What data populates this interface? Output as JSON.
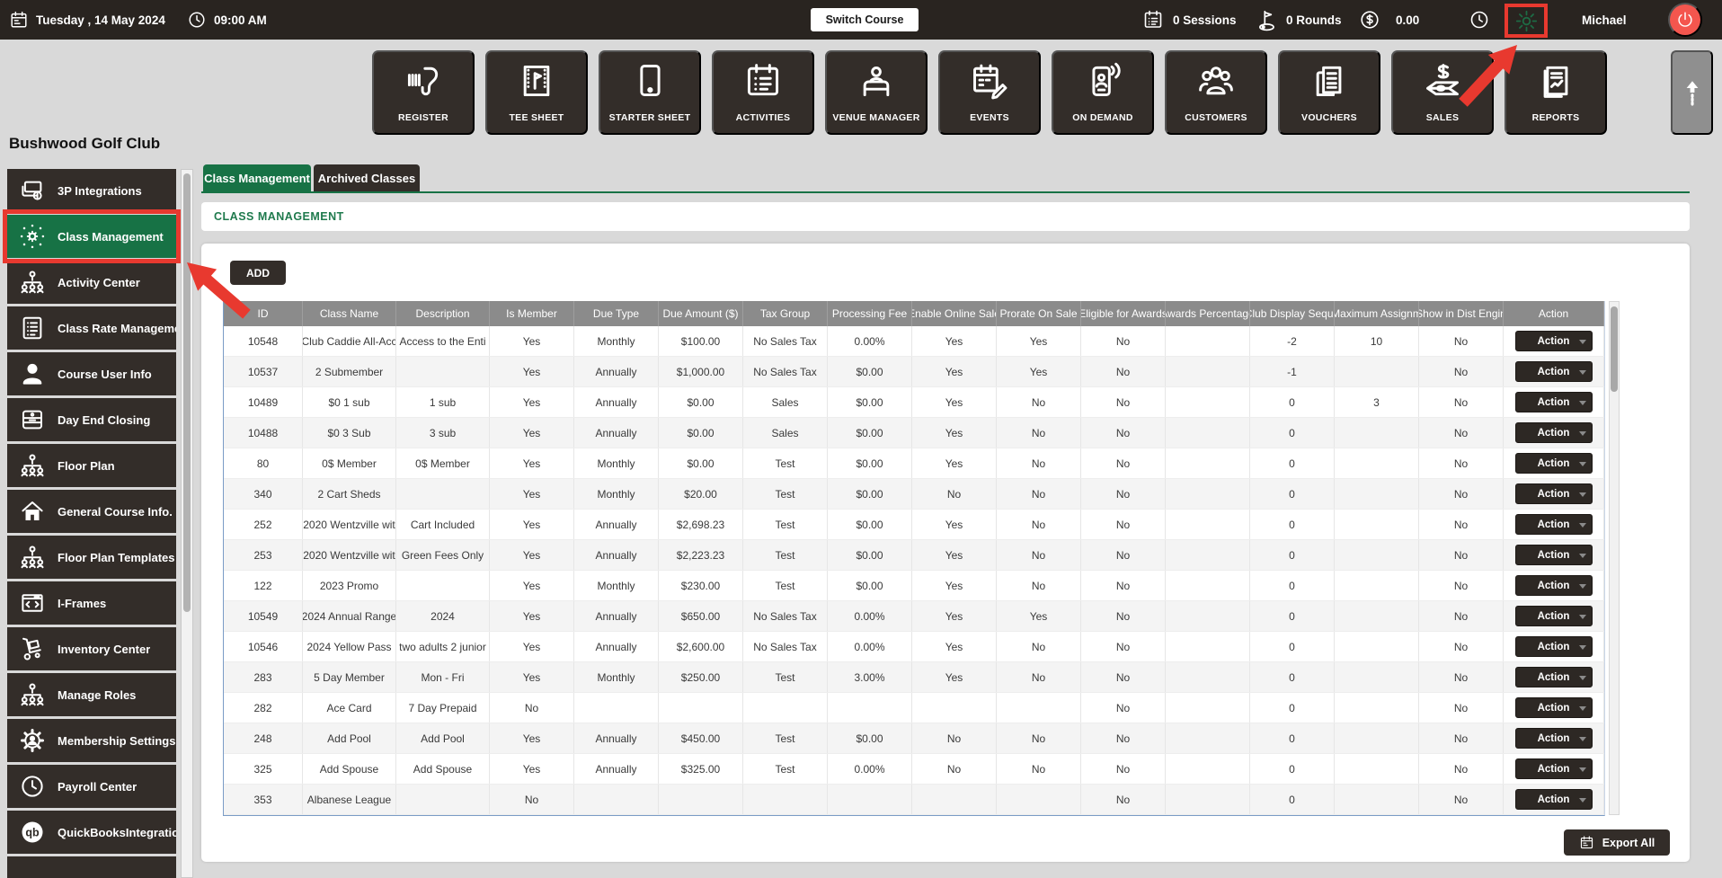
{
  "top_bar": {
    "date": "Tuesday ,  14 May 2024",
    "time": "09:00 AM",
    "switch_course_label": "Switch Course",
    "sessions": "0 Sessions",
    "rounds": "0 Rounds",
    "balance": "0.00",
    "user_name": "Michael"
  },
  "toolbar": {
    "buttons": [
      {
        "label": "REGISTER",
        "icon": "barcode-scanner-icon"
      },
      {
        "label": "TEE SHEET",
        "icon": "tee-sheet-icon"
      },
      {
        "label": "STARTER SHEET",
        "icon": "tablet-icon"
      },
      {
        "label": "ACTIVITIES",
        "icon": "calendar-list-icon"
      },
      {
        "label": "VENUE MANAGER",
        "icon": "venue-icon"
      },
      {
        "label": "EVENTS",
        "icon": "calendar-edit-icon"
      },
      {
        "label": "ON DEMAND",
        "icon": "phone-signal-icon"
      },
      {
        "label": "CUSTOMERS",
        "icon": "people-icon"
      },
      {
        "label": "VOUCHERS",
        "icon": "voucher-icon"
      },
      {
        "label": "SALES",
        "icon": "money-icon"
      },
      {
        "label": "REPORTS",
        "icon": "report-icon"
      }
    ]
  },
  "sidebar": {
    "club_name": "Bushwood Golf Club",
    "items": [
      {
        "label": "3P Integrations",
        "icon": "cards-dollar-icon",
        "active": false
      },
      {
        "label": "Class Management",
        "icon": "class-gear-icon",
        "active": true
      },
      {
        "label": "Activity  Center",
        "icon": "org-icon",
        "active": false
      },
      {
        "label": "Class Rate Management",
        "icon": "list-doc-icon",
        "active": false
      },
      {
        "label": "Course User Info",
        "icon": "person-icon",
        "active": false
      },
      {
        "label": "Day End Closing",
        "icon": "cash-drawer-icon",
        "active": false
      },
      {
        "label": "Floor Plan",
        "icon": "org-icon",
        "active": false
      },
      {
        "label": "General Course Info.",
        "icon": "home-icon",
        "active": false
      },
      {
        "label": "Floor Plan Templates",
        "icon": "org-icon",
        "active": false
      },
      {
        "label": "I-Frames",
        "icon": "code-window-icon",
        "active": false
      },
      {
        "label": "Inventory Center",
        "icon": "handtruck-icon",
        "active": false
      },
      {
        "label": "Manage Roles",
        "icon": "org-icon",
        "active": false
      },
      {
        "label": "Membership Settings",
        "icon": "gear-person-icon",
        "active": false
      },
      {
        "label": "Payroll Center",
        "icon": "clock-icon",
        "active": false
      },
      {
        "label": "QuickBooksIntegration",
        "icon": "quickbooks-icon",
        "active": false
      }
    ]
  },
  "tabs": [
    {
      "label": "Class Management",
      "active": true
    },
    {
      "label": "Archived Classes",
      "active": false
    }
  ],
  "section_title": "CLASS MANAGEMENT",
  "add_button_label": "ADD",
  "export_all_label": "Export All",
  "table": {
    "columns": [
      "ID",
      "Class Name",
      "Description",
      "Is Member",
      "Due Type",
      "Due Amount ($)",
      "Tax Group",
      "Processing Fee",
      "Enable Online Sale",
      "Prorate On Sale",
      "Eligible for Awards",
      "Awards Percentage",
      "Club Display Seque",
      "Maximum Assignm",
      "Show in Dist Engin",
      "Action"
    ],
    "action_label": "Action",
    "rows": [
      [
        "10548",
        "Club Caddie All-Acc",
        "Access to the Enti",
        "Yes",
        "Monthly",
        "$100.00",
        "No Sales Tax",
        "0.00%",
        "Yes",
        "Yes",
        "No",
        "",
        "-2",
        "10",
        "No"
      ],
      [
        "10537",
        "2 Submember",
        "",
        "Yes",
        "Annually",
        "$1,000.00",
        "No Sales Tax",
        "$0.00",
        "Yes",
        "Yes",
        "No",
        "",
        "-1",
        "",
        "No"
      ],
      [
        "10489",
        "$0 1 sub",
        "1 sub",
        "Yes",
        "Annually",
        "$0.00",
        "Sales",
        "$0.00",
        "Yes",
        "No",
        "No",
        "",
        "0",
        "3",
        "No"
      ],
      [
        "10488",
        "$0 3 Sub",
        "3 sub",
        "Yes",
        "Annually",
        "$0.00",
        "Sales",
        "$0.00",
        "Yes",
        "No",
        "No",
        "",
        "0",
        "",
        "No"
      ],
      [
        "80",
        "0$ Member",
        "0$ Member",
        "Yes",
        "Monthly",
        "$0.00",
        "Test",
        "$0.00",
        "Yes",
        "No",
        "No",
        "",
        "0",
        "",
        "No"
      ],
      [
        "340",
        "2 Cart Sheds",
        "",
        "Yes",
        "Monthly",
        "$20.00",
        "Test",
        "$0.00",
        "No",
        "No",
        "No",
        "",
        "0",
        "",
        "No"
      ],
      [
        "252",
        "2020 Wentzville wit",
        "Cart Included",
        "Yes",
        "Annually",
        "$2,698.23",
        "Test",
        "$0.00",
        "Yes",
        "No",
        "No",
        "",
        "0",
        "",
        "No"
      ],
      [
        "253",
        "2020 Wentzville wit",
        "Green Fees Only",
        "Yes",
        "Annually",
        "$2,223.23",
        "Test",
        "$0.00",
        "Yes",
        "No",
        "No",
        "",
        "0",
        "",
        "No"
      ],
      [
        "122",
        "2023 Promo",
        "",
        "Yes",
        "Monthly",
        "$230.00",
        "Test",
        "$0.00",
        "Yes",
        "No",
        "No",
        "",
        "0",
        "",
        "No"
      ],
      [
        "10549",
        "2024 Annual Range",
        "2024",
        "Yes",
        "Annually",
        "$650.00",
        "No Sales Tax",
        "0.00%",
        "Yes",
        "Yes",
        "No",
        "",
        "0",
        "",
        "No"
      ],
      [
        "10546",
        "2024 Yellow Pass",
        "two adults 2 junior",
        "Yes",
        "Annually",
        "$2,600.00",
        "No Sales Tax",
        "0.00%",
        "Yes",
        "No",
        "No",
        "",
        "0",
        "",
        "No"
      ],
      [
        "283",
        "5 Day Member",
        "Mon - Fri",
        "Yes",
        "Monthly",
        "$250.00",
        "Test",
        "3.00%",
        "Yes",
        "No",
        "No",
        "",
        "0",
        "",
        "No"
      ],
      [
        "282",
        "Ace Card",
        "7 Day Prepaid",
        "No",
        "",
        "",
        "",
        "",
        "",
        "",
        "No",
        "",
        "0",
        "",
        "No"
      ],
      [
        "248",
        "Add Pool",
        "Add Pool",
        "Yes",
        "Annually",
        "$450.00",
        "Test",
        "$0.00",
        "No",
        "No",
        "No",
        "",
        "0",
        "",
        "No"
      ],
      [
        "325",
        "Add Spouse",
        "Add Spouse",
        "Yes",
        "Annually",
        "$325.00",
        "Test",
        "0.00%",
        "No",
        "No",
        "No",
        "",
        "0",
        "",
        "No"
      ],
      [
        "353",
        "Albanese League",
        "",
        "No",
        "",
        "",
        "",
        "",
        "",
        "",
        "No",
        "",
        "0",
        "",
        "No"
      ]
    ]
  },
  "colors": {
    "accent_green": "#177245",
    "dark": "#332d29",
    "topbar": "#292420",
    "annotation_red": "#e8392f",
    "table_header": "#8b8b8b",
    "row_alt": "#f4f4f4",
    "power_red": "#f4564e"
  }
}
